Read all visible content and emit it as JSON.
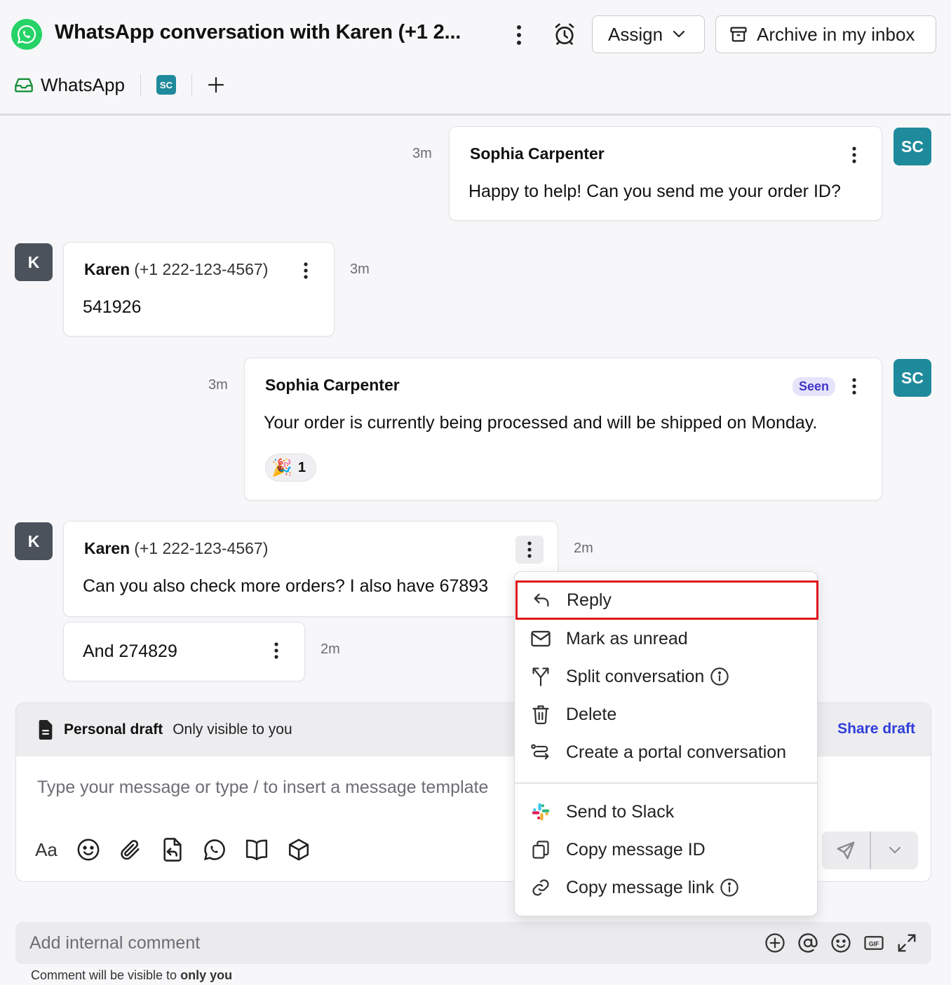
{
  "header": {
    "title": "WhatsApp conversation with Karen (+1 2...",
    "assign_label": "Assign",
    "archive_label": "Archive in my inbox",
    "channel_label": "WhatsApp",
    "assignee_initials": "SC",
    "brand_color": "#25d366"
  },
  "messages": [
    {
      "sender": "Sophia Carpenter",
      "phone": "",
      "time": "3m",
      "text": "Happy to help! Can you send me your order ID?",
      "avatar": "SC"
    },
    {
      "sender": "Karen",
      "phone": "(+1 222-123-4567)",
      "time": "3m",
      "text": "541926",
      "avatar": "K"
    },
    {
      "sender": "Sophia Carpenter",
      "phone": "",
      "time": "3m",
      "text": "Your order is currently being processed and will be shipped on Monday.",
      "avatar": "SC",
      "status": "Seen",
      "reaction_emoji": "🎉",
      "reaction_count": "1"
    },
    {
      "sender": "Karen",
      "phone": "(+1 222-123-4567)",
      "time": "2m",
      "text": "Can you also check more orders? I also have 67893",
      "avatar": "K"
    },
    {
      "sender": "",
      "phone": "",
      "time": "2m",
      "text": "And 274829",
      "avatar": ""
    }
  ],
  "composer": {
    "draft_title": "Personal draft",
    "draft_subtitle": "Only visible to you",
    "share_label": "Share draft",
    "placeholder": "Type your message or type / to insert a message template",
    "format_label": "Aa",
    "tools": [
      "emoji-icon",
      "attach-icon",
      "reply-template-icon",
      "whatsapp-icon",
      "book-icon",
      "cube-icon"
    ]
  },
  "comment": {
    "placeholder": "Add internal comment",
    "hint_prefix": "Comment will be visible to",
    "hint_emphasis": "only you",
    "gif_label": "GIF"
  },
  "context_menu": {
    "items": [
      {
        "label": "Reply",
        "icon": "reply-icon",
        "highlighted": true
      },
      {
        "label": "Mark as unread",
        "icon": "envelope-icon"
      },
      {
        "label": "Split conversation",
        "icon": "split-icon",
        "info": true
      },
      {
        "label": "Delete",
        "icon": "trash-icon"
      },
      {
        "label": "Create a portal conversation",
        "icon": "portal-icon"
      },
      {
        "label": "Send to Slack",
        "icon": "slack-icon"
      },
      {
        "label": "Copy message ID",
        "icon": "copy-icon"
      },
      {
        "label": "Copy message link",
        "icon": "link-icon",
        "info": true
      }
    ],
    "highlight_color": "#e0161b"
  }
}
